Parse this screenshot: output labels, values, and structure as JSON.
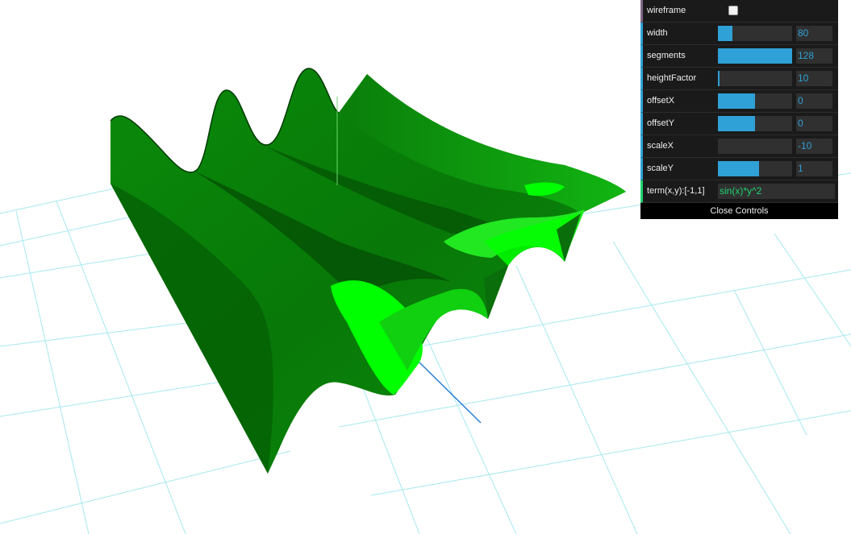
{
  "gui": {
    "wireframe": {
      "label": "wireframe",
      "checked": false
    },
    "controls": [
      {
        "key": "width",
        "label": "width",
        "value": "80",
        "fill": 0.2
      },
      {
        "key": "segments",
        "label": "segments",
        "value": "128",
        "fill": 1.0
      },
      {
        "key": "heightFactor",
        "label": "heightFactor",
        "value": "10",
        "fill": 0.02
      },
      {
        "key": "offsetX",
        "label": "offsetX",
        "value": "0",
        "fill": 0.5
      },
      {
        "key": "offsetY",
        "label": "offsetY",
        "value": "0",
        "fill": 0.5
      },
      {
        "key": "scaleX",
        "label": "scaleX",
        "value": "-10",
        "fill": 0.0
      },
      {
        "key": "scaleY",
        "label": "scaleY",
        "value": "1",
        "fill": 0.55
      }
    ],
    "term": {
      "label": "term(x,y):[-1,1]",
      "value": "sin(x)*y^2"
    },
    "close_label": "Close Controls"
  },
  "colors": {
    "surface_dark": "#006400",
    "surface_mid": "#00a000",
    "surface_bright": "#00ff00",
    "grid": "#a6e8ee",
    "axis_y": "#6cd66c",
    "axis_z": "#2a7fd4"
  }
}
